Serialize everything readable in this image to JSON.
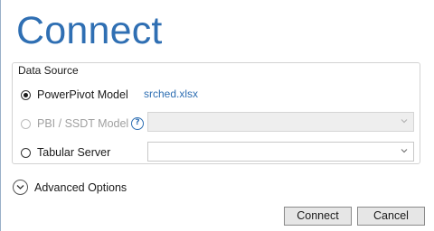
{
  "dialog": {
    "title": "Connect"
  },
  "data_source": {
    "legend": "Data Source",
    "powerpivot": {
      "label": "PowerPivot Model",
      "selected": true,
      "file": "srched.xlsx"
    },
    "pbi_ssdt": {
      "label": "PBI / SSDT Model",
      "enabled": false,
      "help_icon": "question-circle-icon",
      "value": ""
    },
    "tabular": {
      "label": "Tabular Server",
      "value": ""
    }
  },
  "advanced": {
    "label": "Advanced Options",
    "icon": "chevron-down-circle-icon",
    "expanded": false
  },
  "buttons": {
    "connect": "Connect",
    "cancel": "Cancel"
  },
  "colors": {
    "accent": "#2f6fb3",
    "disabled_text": "#a0a0a0",
    "button_bg": "#e6e6e6"
  }
}
